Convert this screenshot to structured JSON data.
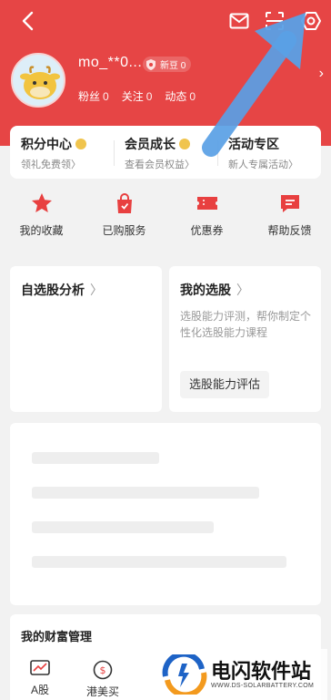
{
  "header": {
    "username": "mo_**0...",
    "level_label": "新豆 0",
    "stats": [
      {
        "label": "粉丝",
        "value": "0"
      },
      {
        "label": "关注",
        "value": "0"
      },
      {
        "label": "动态",
        "value": "0"
      }
    ]
  },
  "cards": [
    {
      "title": "积分中心",
      "subtitle": "领礼免费领〉"
    },
    {
      "title": "会员成长",
      "subtitle": "查看会员权益〉"
    },
    {
      "title": "活动专区",
      "subtitle": "新人专属活动〉"
    }
  ],
  "services": [
    {
      "label": "我的收藏",
      "icon": "star-icon"
    },
    {
      "label": "已购服务",
      "icon": "shopping-bag-icon"
    },
    {
      "label": "优惠券",
      "icon": "coupon-icon"
    },
    {
      "label": "帮助反馈",
      "icon": "message-icon"
    }
  ],
  "panels": {
    "analysis": {
      "title": "自选股分析",
      "chevron": "〉"
    },
    "my_picks": {
      "title": "我的选股",
      "chevron": "〉",
      "description": "选股能力评测，帮你制定个性化选股能力课程",
      "button": "选股能力评估"
    }
  },
  "wealth": {
    "title": "我的财富管理",
    "items": [
      {
        "label": "A股",
        "icon": "chart-line-icon"
      },
      {
        "label": "港美买",
        "icon": "dollar-icon"
      }
    ]
  },
  "watermark": {
    "title": "电闪软件站",
    "subtitle": "WWW.DS-SOLARBATTERY.COM"
  },
  "colors": {
    "header_bg": "#e64545",
    "accent_red": "#e84040",
    "arrow_blue": "#5aa0e6"
  }
}
